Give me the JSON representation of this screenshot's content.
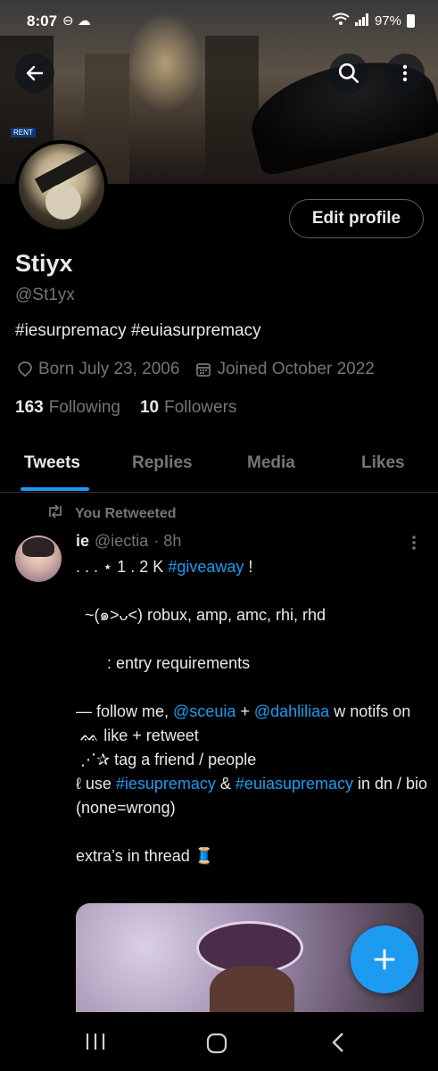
{
  "status_bar": {
    "time": "8:07",
    "battery": "97%",
    "icons": [
      "do-not-disturb-icon",
      "weather-icon",
      "wifi-icon",
      "signal-icon",
      "battery-icon"
    ]
  },
  "profile": {
    "name": "Stiyx",
    "handle": "@St1yx",
    "bio": "#iesurpremacy #euiasurpremacy",
    "born": "Born July 23, 2006",
    "joined": "Joined October 2022",
    "following_count": "163",
    "following_label": "Following",
    "followers_count": "10",
    "followers_label": "Followers",
    "edit_label": "Edit profile"
  },
  "tabs": [
    {
      "label": "Tweets",
      "active": true
    },
    {
      "label": "Replies",
      "active": false
    },
    {
      "label": "Media",
      "active": false
    },
    {
      "label": "Likes",
      "active": false
    }
  ],
  "tweet": {
    "retweet_label": "You Retweeted",
    "author_name": "ie",
    "author_handle": "@iectia",
    "time": "· 8h",
    "line1_pre": ". . . ⋆ 1 . 2 K ",
    "line1_link": "#giveaway",
    "line1_post": " !",
    "line2": "  ~(๑˃ᴗ˂) robux, amp, amc, rhi, rhd",
    "line3": "       : entry requirements",
    "line4_pre": "— follow me, ",
    "mention1": "@sceuia",
    "line4_mid": " + ",
    "mention2": "@dahliliaa",
    "line4_post": " w notifs on",
    "line5": " ᨐ like + retweet",
    "line6": " ⋰✰ tag a friend / people",
    "line7_pre": "ℓ use ",
    "tag1": "#iesupremacy",
    "line7_mid": " & ",
    "tag2": "#euiasupremacy",
    "line7_post": " in dn / bio (none=wrong)",
    "line8": "extra’s in thread 🧵"
  },
  "colors": {
    "accent": "#1d9bf0",
    "text": "#e7e9ea",
    "muted": "#71767b",
    "border": "#2f3336"
  }
}
